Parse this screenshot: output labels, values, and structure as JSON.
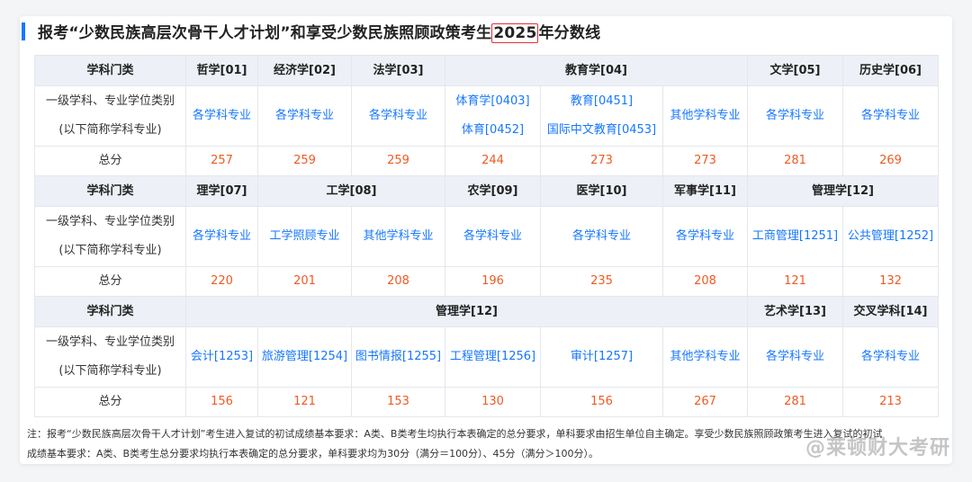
{
  "title": {
    "before": "报考“少数民族高层次骨干人才计划”和享受少数民族照顾政策考生",
    "highlight": "2025",
    "after": "年分数线",
    "colors": {
      "accent": "#1677ff",
      "highlight_border": "#e0303a",
      "score": "#f05a22"
    }
  },
  "row_labels": {
    "category": "学科门类",
    "subject_line1": "一级学科、专业学位类别",
    "subject_line2": "(以下简称学科专业)",
    "total": "总分"
  },
  "block1": {
    "categories": [
      "哲学[01]",
      "经济学[02]",
      "法学[03]",
      "教育学[04]",
      "文学[05]",
      "历史学[06]"
    ],
    "subjects": [
      [
        "各学科专业"
      ],
      [
        "各学科专业"
      ],
      [
        "各学科专业"
      ],
      [
        "体育学[0403]",
        "体育[0452]"
      ],
      [
        "教育[0451]",
        "国际中文教育[0453]"
      ],
      [
        "其他学科专业"
      ],
      [
        "各学科专业"
      ],
      [
        "各学科专业"
      ]
    ],
    "scores": [
      "257",
      "259",
      "259",
      "244",
      "273",
      "273",
      "281",
      "269"
    ]
  },
  "block2": {
    "categories": [
      "理学[07]",
      "工学[08]",
      "农学[09]",
      "医学[10]",
      "军事学[11]",
      "管理学[12]"
    ],
    "subjects": [
      "各学科专业",
      "工学照顾专业",
      "其他学科专业",
      "各学科专业",
      "各学科专业",
      "各学科专业",
      "工商管理[1251]",
      "公共管理[1252]"
    ],
    "scores": [
      "220",
      "201",
      "208",
      "196",
      "235",
      "208",
      "121",
      "132"
    ]
  },
  "block3": {
    "categories": [
      "管理学[12]",
      "艺术学[13]",
      "交叉学科[14]"
    ],
    "subjects": [
      "会计[1253]",
      "旅游管理[1254]",
      "图书情报[1255]",
      "工程管理[1256]",
      "审计[1257]",
      "其他学科专业",
      "各学科专业",
      "各学科专业"
    ],
    "scores": [
      "156",
      "121",
      "153",
      "130",
      "156",
      "267",
      "281",
      "213"
    ]
  },
  "note": {
    "line1": "注：报考“少数民族高层次骨干人才计划”考生进入复试的初试成绩基本要求：A类、B类考生均执行本表确定的总分要求，单科要求由招生单位自主确定。享受少数民族照顾政策考生进入复试的初试",
    "line2": "成绩基本要求：A类、B类考生总分要求均执行本表确定的总分要求，单科要求均为30分（满分＝100分）、45分（满分＞100分）。"
  },
  "watermark": "@莱顿财大考研"
}
